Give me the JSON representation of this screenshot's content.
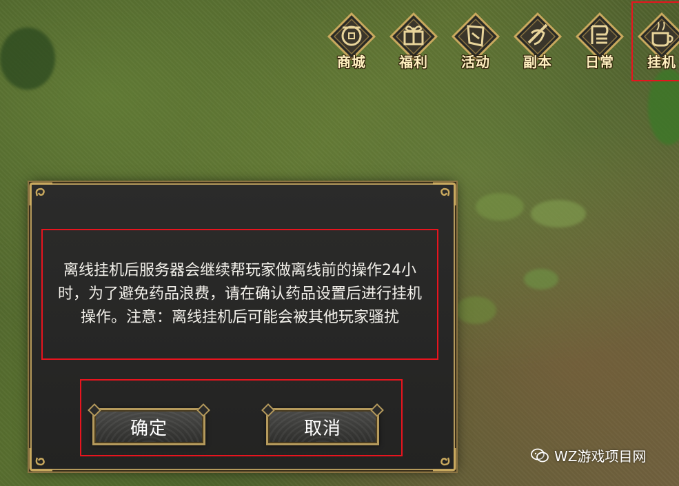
{
  "menu": {
    "items": [
      {
        "label": "商城",
        "icon": "coin-purse-icon"
      },
      {
        "label": "福利",
        "icon": "gift-box-icon"
      },
      {
        "label": "活动",
        "icon": "scroll-banner-icon"
      },
      {
        "label": "副本",
        "icon": "sword-shield-icon"
      },
      {
        "label": "日常",
        "icon": "daily-book-icon"
      },
      {
        "label": "挂机",
        "icon": "teacup-icon"
      }
    ]
  },
  "dialog": {
    "message": "离线挂机后服务器会继续帮玩家做离线前的操作24小时，为了避免药品浪费，请在确认药品设置后进行挂机操作。注意：离线挂机后可能会被其他玩家骚扰",
    "confirm_label": "确定",
    "cancel_label": "取消"
  },
  "watermark": {
    "text": "WZ游戏项目网"
  },
  "colors": {
    "highlight": "#e8141e",
    "gold_border": "#b59a5c",
    "dialog_bg": "#2b2b2a"
  }
}
